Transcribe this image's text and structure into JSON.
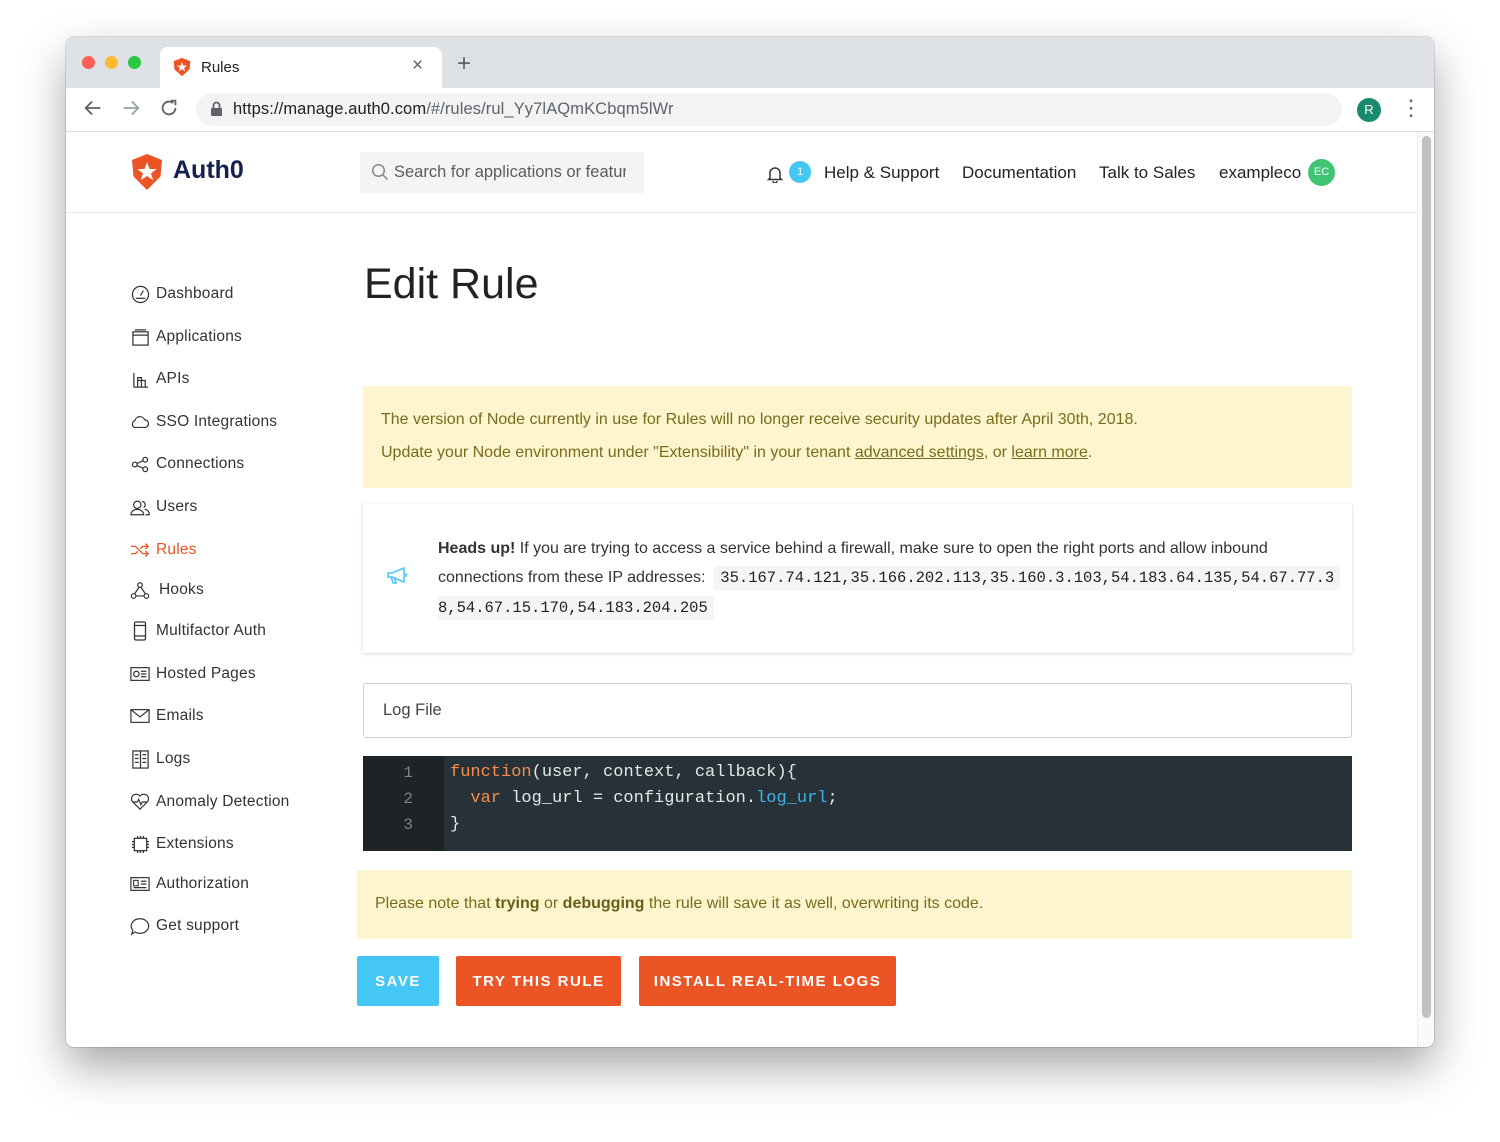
{
  "browser": {
    "tab_title": "Rules",
    "tab_close": "×",
    "new_tab": "+",
    "url_host": "https://manage.auth0.com",
    "url_path": "/#/rules/rul_Yy7lAQmKCbqm5lWr",
    "profile_initial": "R"
  },
  "header": {
    "brand": "Auth0",
    "search_placeholder": "Search for applications or features",
    "notification_count": "1",
    "links": [
      "Help & Support",
      "Documentation",
      "Talk to Sales"
    ],
    "tenant": "exampleco",
    "tenant_avatar": "EC"
  },
  "sidebar": {
    "items": [
      {
        "label": "Dashboard",
        "icon": "dashboard-icon"
      },
      {
        "label": "Applications",
        "icon": "applications-icon"
      },
      {
        "label": "APIs",
        "icon": "apis-icon"
      },
      {
        "label": "SSO Integrations",
        "icon": "cloud-icon"
      },
      {
        "label": "Connections",
        "icon": "connections-icon"
      },
      {
        "label": "Users",
        "icon": "users-icon"
      },
      {
        "label": "Rules",
        "icon": "shuffle-icon",
        "active": true
      },
      {
        "label": "Hooks",
        "icon": "hooks-icon"
      },
      {
        "label": "Multifactor Auth",
        "icon": "phone-icon"
      },
      {
        "label": "Hosted Pages",
        "icon": "hosted-pages-icon"
      },
      {
        "label": "Emails",
        "icon": "envelope-icon"
      },
      {
        "label": "Logs",
        "icon": "logs-icon"
      },
      {
        "label": "Anomaly Detection",
        "icon": "heart-pulse-icon"
      },
      {
        "label": "Extensions",
        "icon": "chip-icon"
      },
      {
        "label": "Authorization",
        "icon": "id-card-icon"
      },
      {
        "label": "Get support",
        "icon": "chat-bubble-icon"
      }
    ]
  },
  "main": {
    "title": "Edit Rule",
    "node_warning": {
      "line1": "The version of Node currently in use for Rules will no longer receive security updates after April 30th, 2018.",
      "line2_prefix": "Update your Node environment under \"Extensibility\" in your tenant ",
      "link1": "advanced settings",
      "mid": ", or ",
      "link2": "learn more",
      "suffix": "."
    },
    "firewall": {
      "heads_up": "Heads up!",
      "text1": " If you are trying to access a service behind a firewall, make sure to open the right ports and allow inbound",
      "text2": "connections from these IP addresses:",
      "ips_line1": "35.167.74.121,35.166.202.113,35.160.3.103,54.183.64.135,54.67.77.3",
      "ips_line2": "8,54.67.15.170,54.183.204.205"
    },
    "rule_name": "Log File",
    "code": {
      "line_numbers": [
        "1",
        "2",
        "3"
      ],
      "line1_kw": "function",
      "line1_rest": "(user, context, callback){",
      "line2_kw": "var",
      "line2_mid": " log_url = configuration.",
      "line2_prop": "log_url",
      "line2_end": ";",
      "line3": "}"
    },
    "note": {
      "prefix": "Please note that ",
      "bold1": "trying",
      "mid": " or ",
      "bold2": "debugging",
      "suffix": " the rule will save it as well, overwriting its code."
    },
    "buttons": {
      "save": "SAVE",
      "try": "TRY THIS RULE",
      "install": "INSTALL REAL-TIME LOGS"
    }
  },
  "colors": {
    "accent": "#eb5424",
    "save_blue": "#44c7f4",
    "warning_bg": "#fcf5cd",
    "editor_bg": "#263238"
  }
}
